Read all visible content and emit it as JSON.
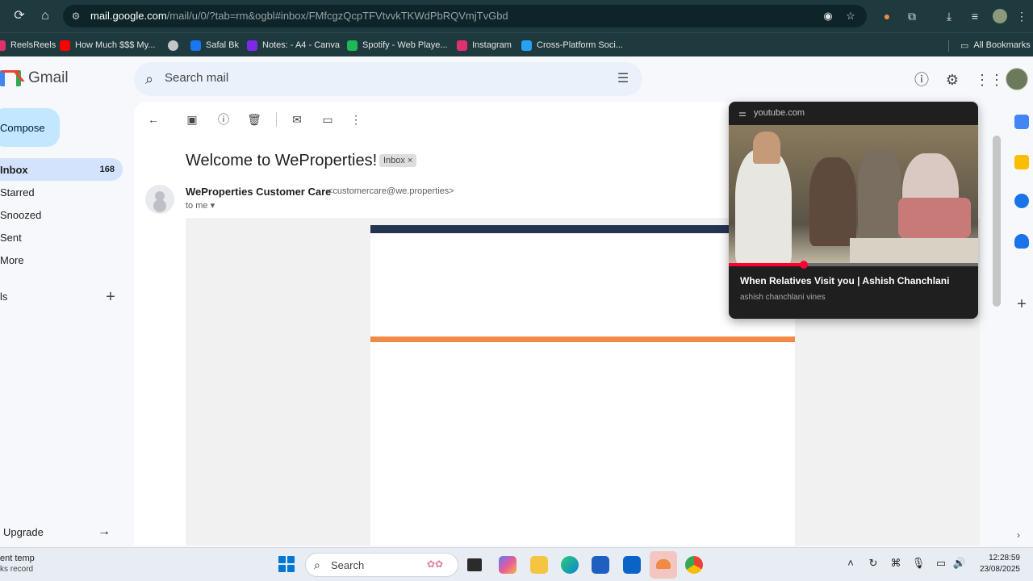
{
  "browser": {
    "url_host": "mail.google.com",
    "url_path": "/mail/u/0/?tab=rm&ogbl#inbox/FMfcgzQcpTFVtvvkTKWdPbRQVmjTvGbd",
    "bookmarks": [
      {
        "label": "ReelsReels",
        "icon": "instagram-icon",
        "color": "#e1306c"
      },
      {
        "label": "How Much $$$ My...",
        "icon": "youtube-icon",
        "color": "#ff0000"
      },
      {
        "label": "",
        "icon": "globe-icon",
        "color": "#c4c7c5"
      },
      {
        "label": "Safal Bk",
        "icon": "facebook-icon",
        "color": "#1877f2"
      },
      {
        "label": "Notes: - A4 - Canva",
        "icon": "canva-icon",
        "color": "#7d2ae8"
      },
      {
        "label": "Spotify - Web Playe...",
        "icon": "spotify-icon",
        "color": "#1db954"
      },
      {
        "label": "Instagram",
        "icon": "instagram-icon",
        "color": "#e1306c"
      },
      {
        "label": "Cross-Platform Soci...",
        "icon": "buffer-icon",
        "color": "#2aa0f0"
      }
    ],
    "all_bookmarks": "All Bookmarks"
  },
  "gmail": {
    "app_name": "Gmail",
    "search_placeholder": "Search mail",
    "compose": "Compose",
    "nav": [
      {
        "label": "Inbox",
        "count": "168",
        "active": true
      },
      {
        "label": "Starred",
        "count": ""
      },
      {
        "label": "Snoozed",
        "count": ""
      },
      {
        "label": "Sent",
        "count": ""
      },
      {
        "label": "More",
        "count": ""
      }
    ],
    "labels_heading": "ls",
    "upgrade": "Upgrade"
  },
  "message": {
    "subject": "Welcome to WeProperties!",
    "chip": "Inbox ×",
    "sender_name": "WeProperties Customer Care",
    "sender_email": "<customercare@we.properties>",
    "to": "to me"
  },
  "youtube_card": {
    "host": "youtube.com",
    "title": "When Relatives Visit you | Ashish Chanchlani",
    "channel": "ashish chanchlani vines",
    "progress": 0.3
  },
  "taskbar": {
    "left_line1": "ent temp",
    "left_line2": "ks record",
    "search": "Search",
    "time": "12:28:59",
    "date": "23/08/2025"
  },
  "colors": {
    "browser_bg": "#1e3a3e",
    "compose_bg": "#c2e7ff",
    "inbox_active": "#d3e3fd",
    "email_navy": "#25344f",
    "email_orange": "#f08a45"
  }
}
